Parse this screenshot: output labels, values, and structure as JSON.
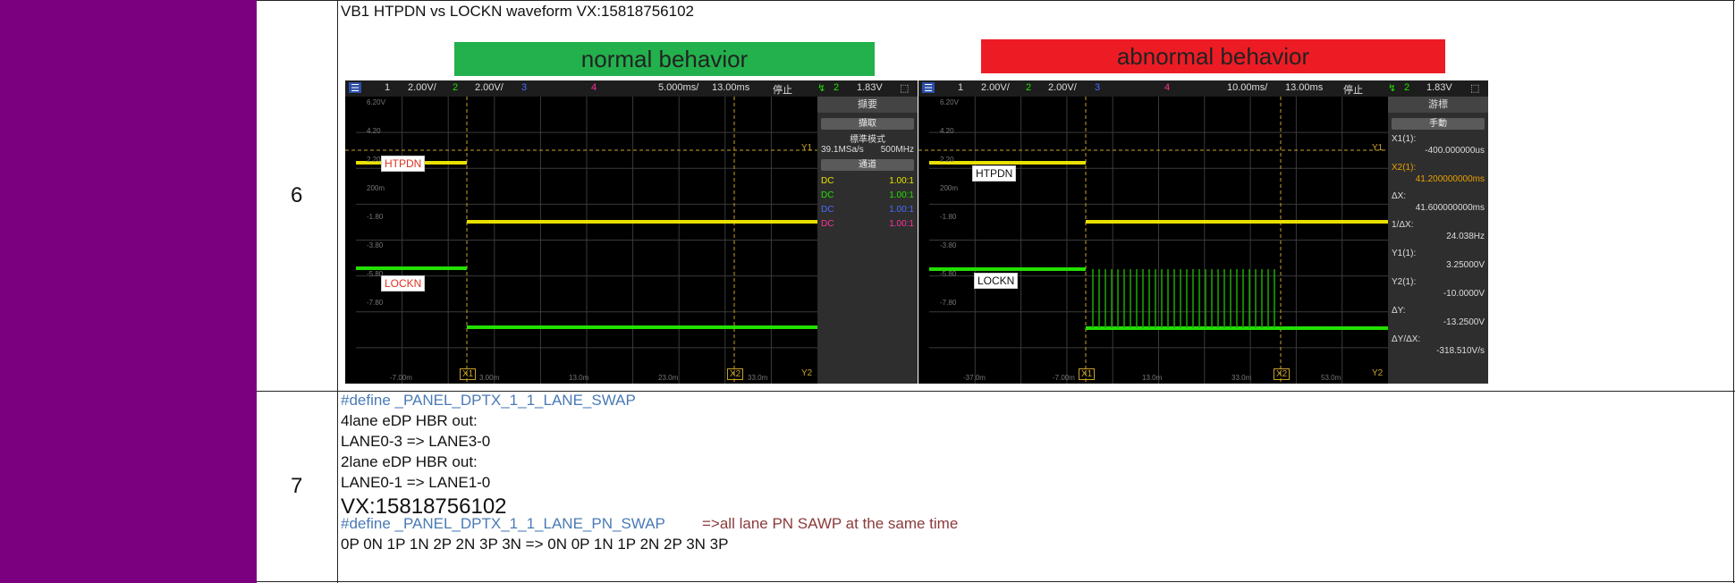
{
  "rows": [
    {
      "number": "6",
      "title": "VB1    HTPDN vs LOCKN  waveform",
      "vx": "VX:15818756102",
      "normal_banner": "normal behavior",
      "abnormal_banner": "abnormal behavior",
      "colors": {
        "normal": "#22b14c",
        "abnormal": "#ed1c24",
        "ch1": "#e8e000",
        "ch2": "#22e000",
        "ch3": "#4a6cff",
        "ch4": "#ff3399"
      },
      "scope_left": {
        "toolbar": {
          "ch1": "1",
          "ch1_scale": "2.00V/",
          "ch2": "2",
          "ch2_scale": "2.00V/",
          "ch3": "3",
          "ch4": "4",
          "timebase": "5.000ms/",
          "delay": "13.00ms",
          "status": "停止",
          "trig_ch": "2",
          "trig_level": "1.83V"
        },
        "panel_title": "擷要",
        "acquire": "擷取",
        "mode": "標準模式",
        "rate": "39.1MSa/s",
        "bw": "500MHz",
        "channels_title": "通道",
        "channels": [
          {
            "c": "DC",
            "v": "1.00:1"
          },
          {
            "c": "DC",
            "v": "1.00:1"
          },
          {
            "c": "DC",
            "v": "1.00:1"
          },
          {
            "c": "DC",
            "v": "1.00:1"
          }
        ],
        "htpdn_label": "HTPDN",
        "lockn_label": "LOCKN",
        "y_axis": [
          "6.20V",
          "4.20",
          "2.20",
          "200m",
          "-1.80",
          "-3.80",
          "-5.80",
          "-7.80"
        ],
        "x_axis": [
          "-7.00m",
          "3.00m",
          "13.0m",
          "23.0m",
          "33.0m"
        ],
        "marker_x1": "X1",
        "marker_x2": "X2",
        "marker_y1": "Y1",
        "marker_y2": "Y2"
      },
      "scope_right": {
        "toolbar": {
          "ch1": "1",
          "ch1_scale": "2.00V/",
          "ch2": "2",
          "ch2_scale": "2.00V/",
          "ch3": "3",
          "ch4": "4",
          "timebase": "10.00ms/",
          "delay": "13.00ms",
          "status": "停止",
          "trig_ch": "2",
          "trig_level": "1.83V"
        },
        "panel_title": "游標",
        "mode": "手動",
        "readouts": [
          {
            "k": "X1(1):",
            "v": "-400.000000us"
          },
          {
            "k": "X2(1):",
            "v": "41.200000000ms"
          },
          {
            "k": "ΔX:",
            "v": "41.600000000ms"
          },
          {
            "k": "1/ΔX:",
            "v": "24.038Hz"
          },
          {
            "k": "Y1(1):",
            "v": "3.25000V"
          },
          {
            "k": "Y2(1):",
            "v": "-10.0000V"
          },
          {
            "k": "ΔY:",
            "v": "-13.2500V"
          },
          {
            "k": "ΔY/ΔX:",
            "v": "-318.510V/s"
          }
        ],
        "htpdn_label": "HTPDN",
        "lockn_label": "LOCKN",
        "y_axis": [
          "6.20V",
          "4.20",
          "2.20",
          "200m",
          "-1.80",
          "-3.80",
          "-5.80",
          "-7.80"
        ],
        "x_axis": [
          "-37.0m",
          "-7.00m",
          "13.0m",
          "33.0m",
          "53.0m"
        ],
        "marker_x1": "X1",
        "marker_x2": "X2",
        "marker_y1": "Y1",
        "marker_y2": "Y2"
      }
    },
    {
      "number": "7",
      "define1": "#define _PANEL_DPTX_1_1_LANE_SWAP",
      "l1": "4lane eDP HBR out:",
      "l2": "LANE0-3 => LANE3-0",
      "l3": "2lane eDP HBR out:",
      "l4": "LANE0-1 => LANE1-0",
      "vx": "VX:15818756102",
      "define2": "#define _PANEL_DPTX_1_1_LANE_PN_SWAP",
      "note": "=>all lane PN SAWP at the same time",
      "l5": "0P 0N 1P 1N 2P 2N 3P 3N => 0N 0P 1N 1P 2N 2P 3N 3P"
    }
  ]
}
